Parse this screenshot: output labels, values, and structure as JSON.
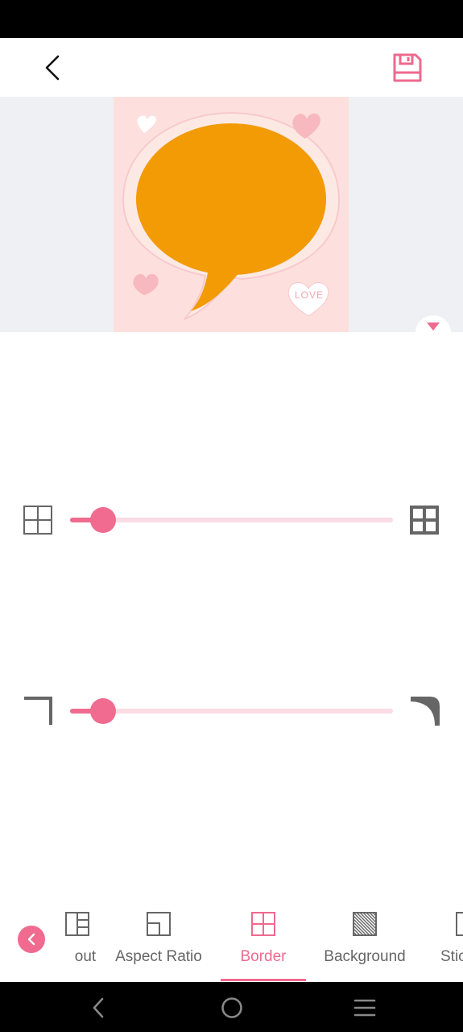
{
  "header": {
    "back_icon": "back-arrow-icon",
    "save_icon": "save-floppy-icon"
  },
  "canvas": {
    "background_color": "#fde0dd",
    "bubble_color": "#f29b05",
    "sticker_text": "LOVE"
  },
  "sliders": [
    {
      "id": "border-width",
      "left_icon": "grid-thin-icon",
      "right_icon": "grid-thick-icon",
      "value": 0.1
    },
    {
      "id": "corner-radius",
      "left_icon": "corner-square-icon",
      "right_icon": "corner-round-icon",
      "value": 0.1
    }
  ],
  "toolbar": {
    "tabs": [
      {
        "label": "out",
        "icon": "layout-icon"
      },
      {
        "label": "Aspect Ratio",
        "icon": "aspect-ratio-icon"
      },
      {
        "label": "Border",
        "icon": "border-icon",
        "active": true
      },
      {
        "label": "Background",
        "icon": "background-icon"
      },
      {
        "label": "Stic",
        "icon": "sticker-icon"
      }
    ]
  },
  "colors": {
    "accent": "#ee6a8e",
    "slider_track": "#fbdbe4",
    "preview_bg": "#eff0f4"
  },
  "nav": {
    "back_icon": "nav-back-icon",
    "home_icon": "nav-home-icon",
    "menu_icon": "nav-menu-icon"
  }
}
